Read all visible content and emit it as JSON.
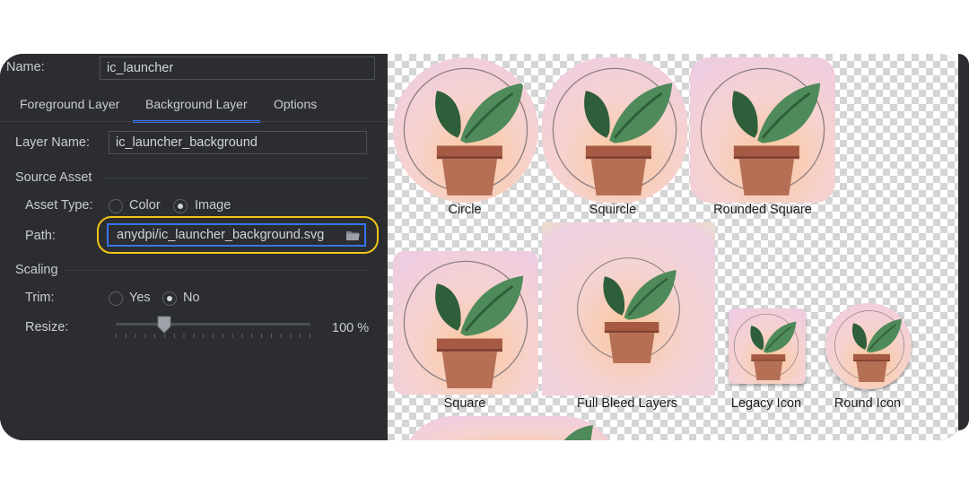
{
  "form": {
    "name_label": "Name:",
    "name_value": "ic_launcher",
    "tabs": [
      {
        "label": "Foreground Layer"
      },
      {
        "label": "Background Layer"
      },
      {
        "label": "Options"
      }
    ],
    "layer_name_label": "Layer Name:",
    "layer_name_value": "ic_launcher_background",
    "source_asset_title": "Source Asset",
    "asset_type_label": "Asset Type:",
    "asset_type_options": [
      "Color",
      "Image"
    ],
    "asset_type_selected": "Image",
    "path_label": "Path:",
    "path_value": "anydpi/ic_launcher_background.svg",
    "scaling_title": "Scaling",
    "trim_label": "Trim:",
    "trim_options": [
      "Yes",
      "No"
    ],
    "trim_selected": "No",
    "resize_label": "Resize:",
    "resize_value": "100 %",
    "resize_fraction": 0.25,
    "highlight_color": "#f2c417",
    "accent_color": "#3574f0"
  },
  "preview": {
    "shapes": [
      {
        "caption": "Circle"
      },
      {
        "caption": "Squircle"
      },
      {
        "caption": "Rounded Square"
      },
      {
        "caption": "Square"
      },
      {
        "caption": "Full Bleed Layers"
      },
      {
        "caption": "Legacy Icon"
      },
      {
        "caption": "Round Icon"
      }
    ],
    "icon": "potted-plant-icon"
  }
}
